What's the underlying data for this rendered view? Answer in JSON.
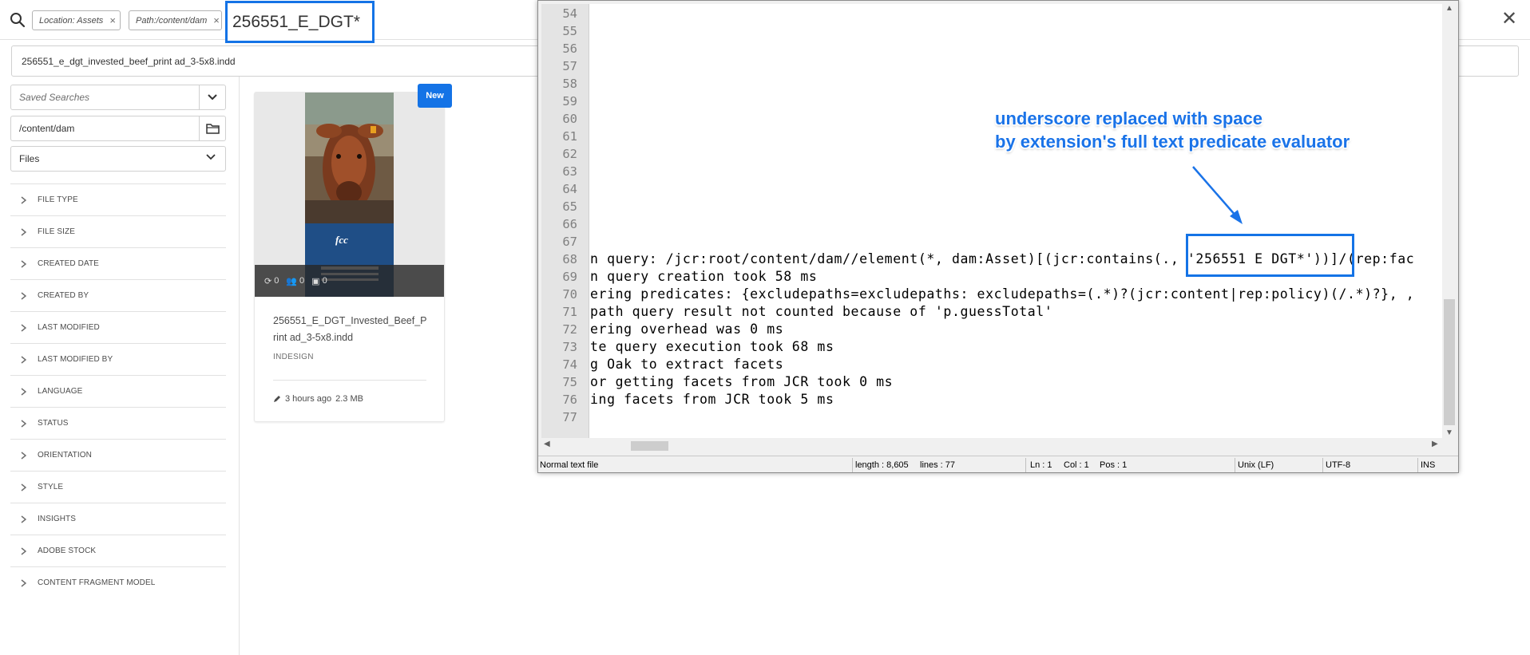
{
  "search": {
    "tags": [
      {
        "label": "Location: Assets",
        "remove": "×"
      },
      {
        "label": "Path:/content/dam",
        "remove": "×"
      }
    ],
    "query": "256551_E_DGT*",
    "close": "✕",
    "suggestion": "256551_e_dgt_invested_beef_print ad_3-5x8.indd"
  },
  "rail": {
    "saved_searches_placeholder": "Saved Searches",
    "path": "/content/dam",
    "type_select": "Files",
    "facets": [
      "FILE TYPE",
      "FILE SIZE",
      "CREATED DATE",
      "CREATED BY",
      "LAST MODIFIED",
      "LAST MODIFIED BY",
      "LANGUAGE",
      "STATUS",
      "ORIENTATION",
      "STYLE",
      "INSIGHTS",
      "ADOBE STOCK",
      "CONTENT FRAGMENT MODEL"
    ]
  },
  "card": {
    "badge": "New",
    "title": "256551_E_DGT_Invested_Beef_Print ad_3-5x8.indd",
    "type": "INDESIGN",
    "modified": "3 hours ago",
    "size": "2.3 MB",
    "counts": [
      "0",
      "0",
      "0"
    ],
    "ad_brand": "fcc"
  },
  "editor": {
    "line_numbers": [
      "54",
      "55",
      "56",
      "57",
      "58",
      "59",
      "60",
      "61",
      "62",
      "63",
      "64",
      "65",
      "66",
      "67",
      "68",
      "69",
      "70",
      "71",
      "72",
      "73",
      "74",
      "75",
      "76",
      "77"
    ],
    "lines": [
      {
        "n": "68",
        "text": "n query: /jcr:root/content/dam//element(*, dam:Asset)[(jcr:contains(., '256551 E DGT*'))]/(rep:fac"
      },
      {
        "n": "69",
        "text": "n query creation took 58 ms"
      },
      {
        "n": "70",
        "text": "ering predicates: {excludepaths=excludepaths: excludepaths=(.*)?(jcr:content|rep:policy)(/.*)?}, ,"
      },
      {
        "n": "71",
        "text": "path query result not counted because of 'p.guessTotal'"
      },
      {
        "n": "72",
        "text": "ering overhead was 0 ms"
      },
      {
        "n": "73",
        "text": "te query execution took 68 ms"
      },
      {
        "n": "74",
        "text": "g Oak to extract facets"
      },
      {
        "n": "75",
        "text": "or getting facets from JCR took 0 ms"
      },
      {
        "n": "76",
        "text": "ing facets from JCR took 5 ms"
      }
    ]
  },
  "status": {
    "type": "Normal text file",
    "length": "length : 8,605",
    "lines": "lines : 77",
    "ln": "Ln : 1",
    "col": "Col : 1",
    "pos": "Pos : 1",
    "eol": "Unix (LF)",
    "encoding": "UTF-8",
    "mode": "INS"
  },
  "annotation": {
    "line1": "underscore replaced with space",
    "line2": "by extension's full text predicate evaluator",
    "color": "#1a73e8"
  },
  "colors": {
    "accent": "#1473e6"
  }
}
